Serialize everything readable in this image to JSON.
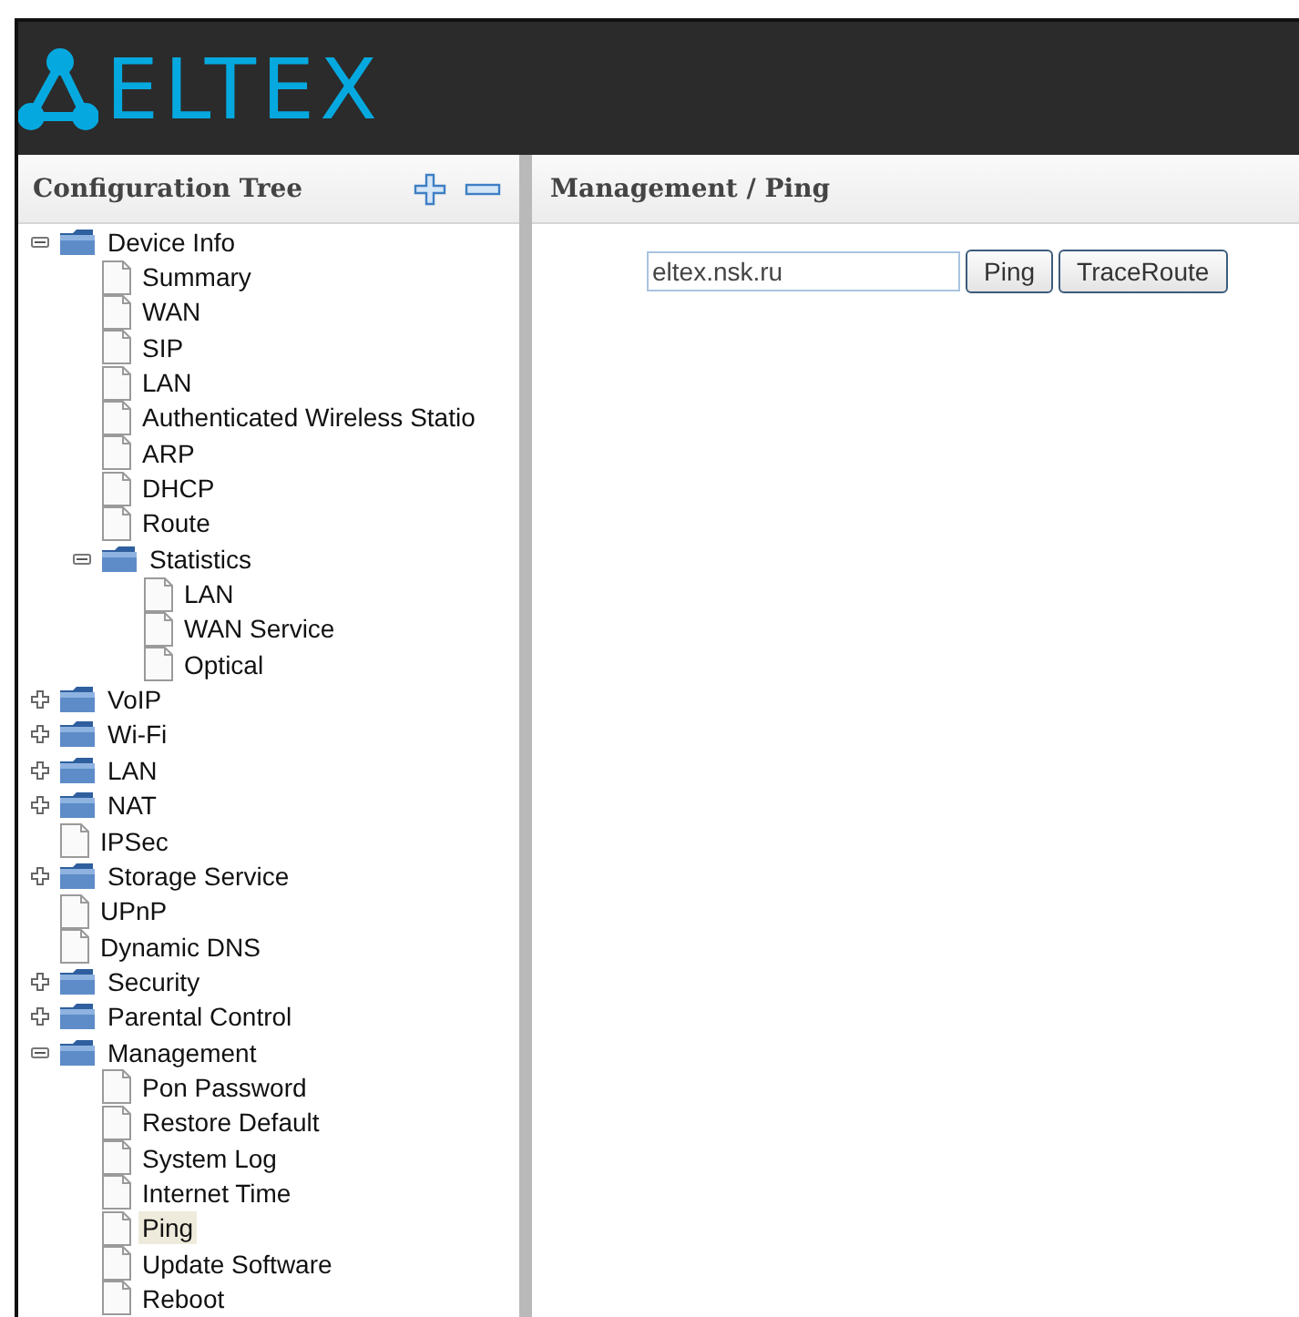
{
  "logo": {
    "text": "ELTEX"
  },
  "tree": {
    "title": "Configuration Tree",
    "items": [
      {
        "label": "Device Info",
        "kind": "folder",
        "expanded": true,
        "selected": false,
        "children": [
          {
            "label": "Summary",
            "kind": "page",
            "selected": false
          },
          {
            "label": "WAN",
            "kind": "page",
            "selected": false
          },
          {
            "label": "SIP",
            "kind": "page",
            "selected": false
          },
          {
            "label": "LAN",
            "kind": "page",
            "selected": false
          },
          {
            "label": "Authenticated Wireless Statio",
            "kind": "page",
            "selected": false
          },
          {
            "label": "ARP",
            "kind": "page",
            "selected": false
          },
          {
            "label": "DHCP",
            "kind": "page",
            "selected": false
          },
          {
            "label": "Route",
            "kind": "page",
            "selected": false
          },
          {
            "label": "Statistics",
            "kind": "folder",
            "expanded": true,
            "selected": false,
            "children": [
              {
                "label": "LAN",
                "kind": "page",
                "selected": false
              },
              {
                "label": "WAN Service",
                "kind": "page",
                "selected": false
              },
              {
                "label": "Optical",
                "kind": "page",
                "selected": false
              }
            ]
          }
        ]
      },
      {
        "label": "VoIP",
        "kind": "folder",
        "expanded": false,
        "selected": false
      },
      {
        "label": "Wi-Fi",
        "kind": "folder",
        "expanded": false,
        "selected": false
      },
      {
        "label": "LAN",
        "kind": "folder",
        "expanded": false,
        "selected": false
      },
      {
        "label": "NAT",
        "kind": "folder",
        "expanded": false,
        "selected": false
      },
      {
        "label": "IPSec",
        "kind": "page",
        "selected": false
      },
      {
        "label": "Storage Service",
        "kind": "folder",
        "expanded": false,
        "selected": false
      },
      {
        "label": "UPnP",
        "kind": "page",
        "selected": false
      },
      {
        "label": "Dynamic DNS",
        "kind": "page",
        "selected": false
      },
      {
        "label": "Security",
        "kind": "folder",
        "expanded": false,
        "selected": false
      },
      {
        "label": "Parental Control",
        "kind": "folder",
        "expanded": false,
        "selected": false
      },
      {
        "label": "Management",
        "kind": "folder",
        "expanded": true,
        "selected": false,
        "children": [
          {
            "label": "Pon Password",
            "kind": "page",
            "selected": false
          },
          {
            "label": "Restore Default",
            "kind": "page",
            "selected": false
          },
          {
            "label": "System Log",
            "kind": "page",
            "selected": false
          },
          {
            "label": "Internet Time",
            "kind": "page",
            "selected": false
          },
          {
            "label": "Ping",
            "kind": "page",
            "selected": true
          },
          {
            "label": "Update Software",
            "kind": "page",
            "selected": false
          },
          {
            "label": "Reboot",
            "kind": "page",
            "selected": false
          }
        ]
      }
    ]
  },
  "main": {
    "breadcrumb": "Management / Ping",
    "host_field": {
      "value": "eltex.nsk.ru"
    },
    "buttons": [
      "Ping",
      "TraceRoute"
    ]
  }
}
